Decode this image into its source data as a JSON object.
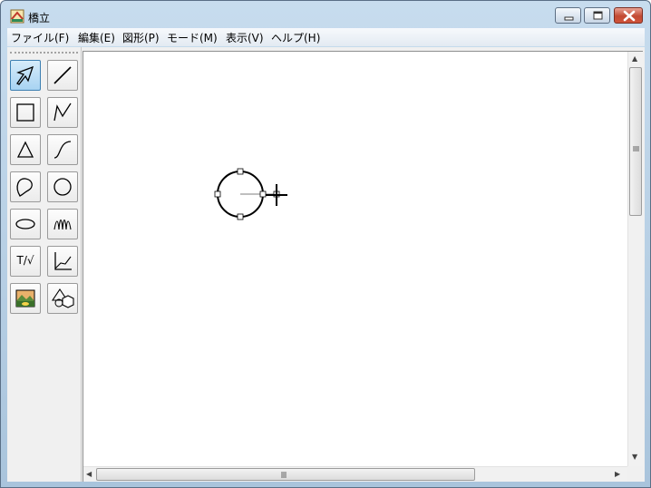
{
  "window": {
    "title": "橋立",
    "app_icon": "app-icon",
    "controls": {
      "minimize": "minimize-icon",
      "maximize": "maximize-icon",
      "close": "close-icon"
    }
  },
  "menubar": {
    "items": [
      {
        "label": "ファイル(F)"
      },
      {
        "label": "編集(E)"
      },
      {
        "label": "図形(P)"
      },
      {
        "label": "モード(M)"
      },
      {
        "label": "表示(V)"
      },
      {
        "label": "ヘルプ(H)"
      }
    ]
  },
  "toolbox": {
    "tools": [
      {
        "name": "select",
        "icon": "select-arrow-icon",
        "active": true
      },
      {
        "name": "line",
        "icon": "line-icon",
        "active": false
      },
      {
        "name": "rectangle",
        "icon": "rectangle-icon",
        "active": false
      },
      {
        "name": "polyline",
        "icon": "polyline-icon",
        "active": false
      },
      {
        "name": "polygon",
        "icon": "polygon-icon",
        "active": false
      },
      {
        "name": "curve",
        "icon": "curve-icon",
        "active": false
      },
      {
        "name": "closed-curve",
        "icon": "closed-curve-icon",
        "active": false
      },
      {
        "name": "circle",
        "icon": "circle-icon",
        "active": false
      },
      {
        "name": "ellipse",
        "icon": "ellipse-icon",
        "active": false
      },
      {
        "name": "freehand",
        "icon": "freehand-icon",
        "active": false
      },
      {
        "name": "text",
        "icon": "text-formula-icon",
        "label": "T/√",
        "active": false
      },
      {
        "name": "graph",
        "icon": "graph-icon",
        "active": false
      },
      {
        "name": "image",
        "icon": "image-icon",
        "active": false
      },
      {
        "name": "solid",
        "icon": "solid-shape-icon",
        "active": false
      }
    ]
  },
  "canvas": {
    "selected_shape": "circle",
    "cursor": "crosshair-cursor"
  },
  "colors": {
    "active_tool": "#a8d3f2",
    "canvas_bg": "#ffffff",
    "titlebar": "#b9d1ea",
    "close_button": "#c24a33"
  }
}
